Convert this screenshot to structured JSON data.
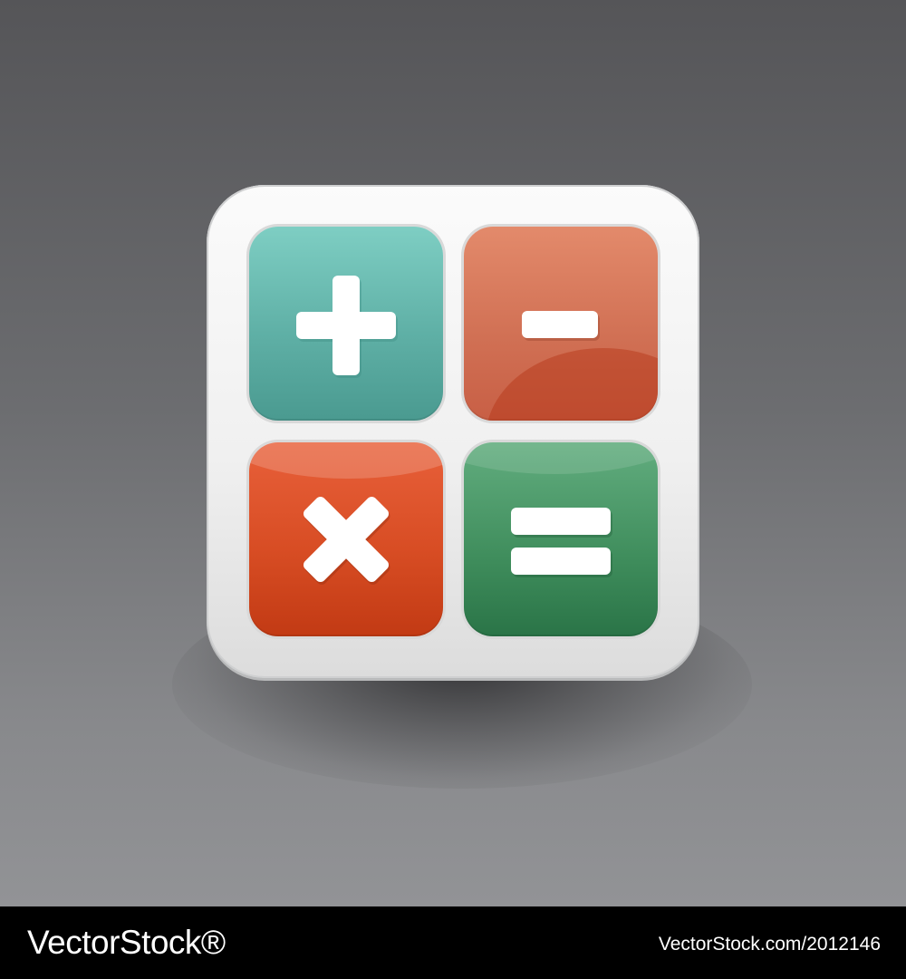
{
  "icon": {
    "tiles": [
      {
        "symbol": "plus",
        "color": "#5fb0a6"
      },
      {
        "symbol": "minus",
        "color": "#d06f53"
      },
      {
        "symbol": "multiply",
        "color": "#d84d24"
      },
      {
        "symbol": "equals",
        "color": "#3f8d5c"
      }
    ]
  },
  "watermark": {
    "logo_text": "VectorStock®",
    "image_id": "VectorStock.com/2012146"
  }
}
